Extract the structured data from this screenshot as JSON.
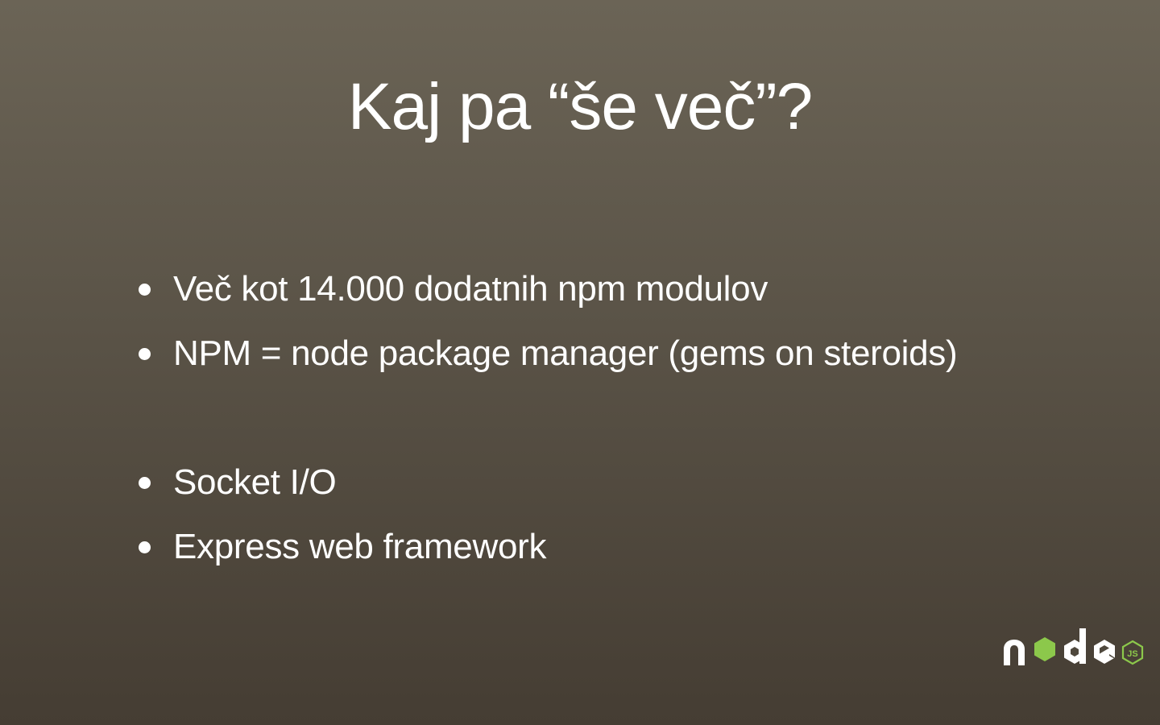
{
  "slide": {
    "title": "Kaj pa “še več”?",
    "bullets": [
      "Več kot 14.000 dodatnih npm modulov",
      "NPM = node package manager (gems on steroids)",
      "Socket I/O",
      "Express web framework"
    ]
  },
  "logo": {
    "name": "node-js-logo",
    "text": "node",
    "badge": "JS",
    "accent_color": "#8cc84b",
    "letter_color": "#ffffff"
  }
}
